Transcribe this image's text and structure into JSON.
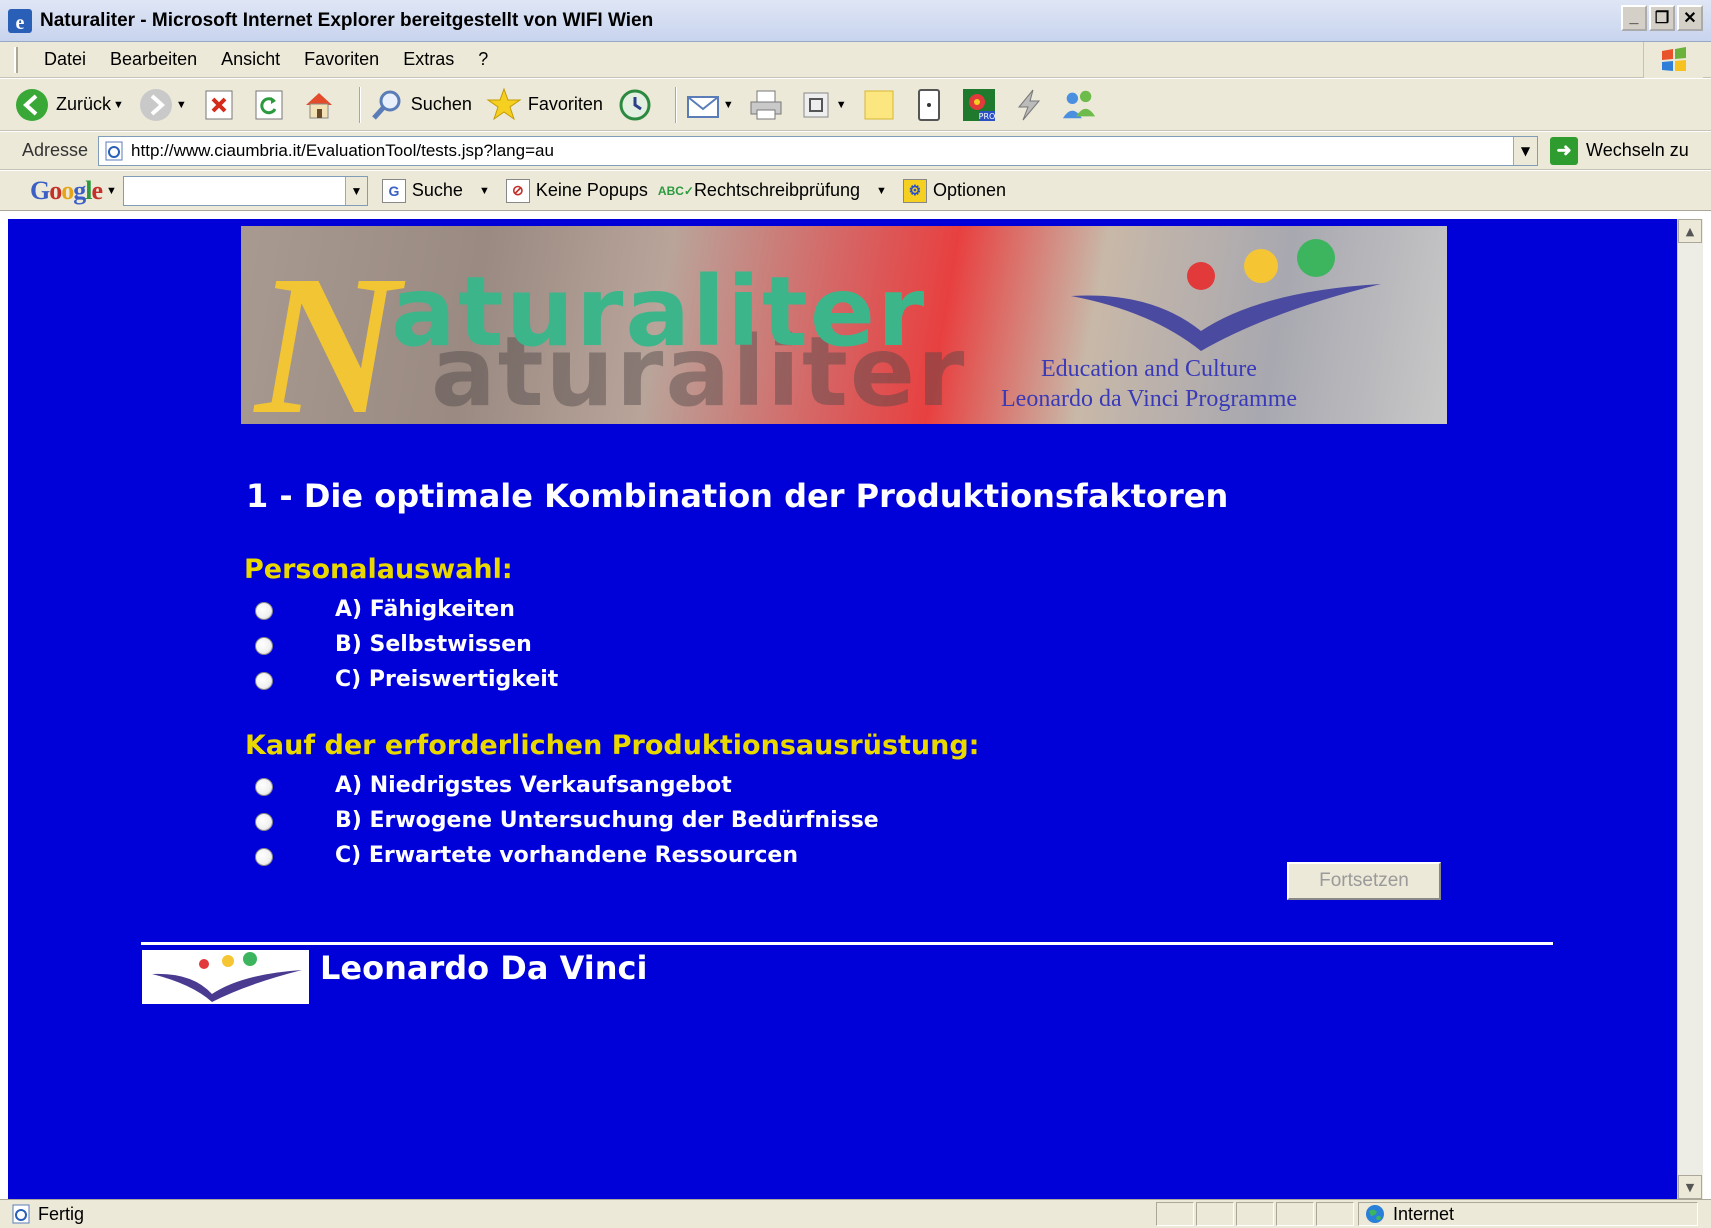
{
  "window": {
    "title": "Naturaliter - Microsoft Internet Explorer bereitgestellt von WIFI Wien",
    "buttons": [
      "_",
      "❐",
      "✕"
    ]
  },
  "menu": [
    "Datei",
    "Bearbeiten",
    "Ansicht",
    "Favoriten",
    "Extras",
    "?"
  ],
  "toolbar": {
    "back_label": "Zurück",
    "search_label": "Suchen",
    "favorites_label": "Favoriten"
  },
  "address": {
    "label": "Adresse",
    "url": "http://www.ciaumbria.it/EvaluationTool/tests.jsp?lang=au",
    "go_label": "Wechseln zu"
  },
  "google_toolbar": {
    "logo_letters": [
      "G",
      "o",
      "o",
      "g",
      "l",
      "e"
    ],
    "search_label": "Suche",
    "popups_label": "Keine Popups",
    "spell_label": "Rechtschreibprüfung",
    "options_label": "Optionen"
  },
  "banner": {
    "logo_text": "aturaliter",
    "logo_initial": "N",
    "line1": "Education and Culture",
    "line2": "Leonardo da Vinci Programme"
  },
  "question": {
    "title": "1 - Die optimale Kombination der Produktionsfaktoren",
    "sections": [
      {
        "title": "Personalauswahl:",
        "options": [
          "A) Fähigkeiten",
          "B) Selbstwissen",
          "C) Preiswertigkeit"
        ]
      },
      {
        "title": "Kauf der erforderlichen Produktionsausrüstung:",
        "options": [
          "A) Niedrigstes Verkaufsangebot",
          "B) Erwogene Untersuchung der Bedürfnisse",
          "C) Erwartete vorhandene Ressourcen"
        ]
      }
    ],
    "continue_label": "Fortsetzen"
  },
  "footer": {
    "program": "Leonardo Da Vinci"
  },
  "status": {
    "text": "Fertig",
    "zone": "Internet"
  },
  "colors": {
    "page_background": "#0000d8",
    "section_title": "#e8d800",
    "text": "#ffffff"
  }
}
